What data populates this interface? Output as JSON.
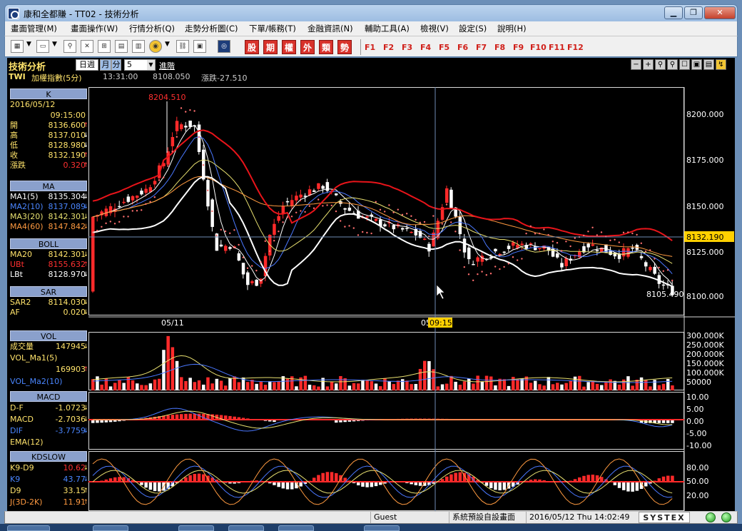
{
  "window": {
    "title": "康和全都賺 - TT02 - 技術分析",
    "min": "▁",
    "max": "❐",
    "close": "✕"
  },
  "menu": [
    "畫面管理(M)",
    "畫面操作(W)",
    "行情分析(Q)",
    "走勢分析圖(C)",
    "下單/帳務(T)",
    "金融資訊(N)",
    "輔助工具(A)",
    "檢視(V)",
    "設定(S)",
    "說明(H)"
  ],
  "toolbar": {
    "red_buttons": [
      "股",
      "期",
      "權",
      "外",
      "類",
      "勢"
    ],
    "fkeys": [
      "F1",
      "F2",
      "F3",
      "F4",
      "F5",
      "F6",
      "F7",
      "F8",
      "F9",
      "F10",
      "F11",
      "F12"
    ]
  },
  "header": {
    "title": "技術分析",
    "period_day": "日週",
    "period_month": "月",
    "period_min": "分",
    "period_n": "5",
    "advanced": "進階",
    "code": "TWI",
    "name": "加權指數(5分)",
    "time": "13:31:00",
    "price": "8108.050",
    "change_label": "漲跌-27.510",
    "controls": [
      "−",
      "+",
      "⚲",
      "⚲",
      "☐",
      "▣",
      "▤",
      "↯"
    ]
  },
  "left_panel": {
    "k": {
      "header": "K",
      "date": "2016/05/12",
      "time": "09:15:00",
      "rows": [
        {
          "k": "開",
          "v": "8136.600",
          "a": "↑"
        },
        {
          "k": "高",
          "v": "8137.010",
          "a": "↓"
        },
        {
          "k": "低",
          "v": "8128.980",
          "a": "↓"
        },
        {
          "k": "收",
          "v": "8132.190",
          "a": "↑"
        },
        {
          "k": "漲跌",
          "v": "0.320",
          "a": "↑"
        }
      ]
    },
    "ma": {
      "header": "MA",
      "rows": [
        {
          "k": "MA1(5)",
          "v": "8135.304",
          "a": "↓"
        },
        {
          "k": "MA2(10)",
          "v": "8137.089",
          "a": "↓"
        },
        {
          "k": "MA3(20)",
          "v": "8142.301",
          "a": "↓"
        },
        {
          "k": "MA4(60)",
          "v": "8147.842",
          "a": "↓"
        }
      ]
    },
    "boll": {
      "header": "BOLL",
      "rows": [
        {
          "k": "MA20",
          "v": "8142.301",
          "a": "↓"
        },
        {
          "k": "UBt",
          "v": "8155.632",
          "a": "↑"
        },
        {
          "k": "LBt",
          "v": "8128.970",
          "a": "↓"
        }
      ]
    },
    "sar": {
      "header": "SAR",
      "rows": [
        {
          "k": "SAR2",
          "v": "8114.030",
          "a": "↓"
        },
        {
          "k": "AF",
          "v": "0.020",
          "a": "↓"
        }
      ]
    },
    "vol": {
      "header": "VOL",
      "rows": [
        {
          "k": "成交量",
          "v": "147945",
          "a": "↓"
        },
        {
          "k": "VOL_Ma1(5)",
          "v": "",
          "a": ""
        },
        {
          "k": "",
          "v": "169903",
          "a": "↑"
        },
        {
          "k": "VOL_Ma2(10)",
          "v": "",
          "a": ""
        }
      ]
    },
    "macd": {
      "header": "MACD",
      "rows": [
        {
          "k": "D-F",
          "v": "-1.0723",
          "a": "↓"
        },
        {
          "k": "MACD",
          "v": "-2.7036",
          "a": "↓"
        },
        {
          "k": "DIF",
          "v": "-3.7759",
          "a": "↓"
        },
        {
          "k": "EMA(12)",
          "v": "",
          "a": ""
        }
      ]
    },
    "kdslow": {
      "header": "KDSLOW",
      "rows": [
        {
          "k": "K9-D9",
          "v": "10.62",
          "a": "↓"
        },
        {
          "k": "K9",
          "v": "43.77",
          "a": "↓"
        },
        {
          "k": "D9",
          "v": "33.15",
          "a": "↑"
        },
        {
          "k": "J(3D-2K)",
          "v": "11.91",
          "a": "↑"
        }
      ]
    }
  },
  "chart": {
    "price_ticks": [
      "8200.000",
      "8175.000",
      "8150.000",
      "8125.000",
      "8100.000"
    ],
    "high_label": "8204.510",
    "low_label": "8105.490",
    "current_price": "8132.190",
    "date_labels": [
      "05/11",
      "05"
    ],
    "cursor_time": "09:15",
    "vol_ticks": [
      "300.000K",
      "250.000K",
      "200.000K",
      "150.000K",
      "100.000K",
      "50000"
    ],
    "macd_ticks": [
      "10.00",
      "5.00",
      "0.00",
      "-5.00",
      "-10.00"
    ],
    "kd_ticks": [
      "80.00",
      "50.00",
      "20.00"
    ]
  },
  "chart_data": {
    "type": "candlestick",
    "title": "加權指數(5分)",
    "ylim": [
      8095,
      8215
    ],
    "annotations": [
      "8204.510",
      "8105.490",
      "8132.190"
    ],
    "x_labels": [
      "05/11",
      "05/12 09:15"
    ]
  },
  "status": {
    "user": "Guest",
    "layout": "系統預設自設畫面",
    "datetime": "2016/05/12 Thu 14:02:49",
    "brand": "SYSTEX"
  },
  "colors": {
    "up": "#ff2a2a",
    "down": "#ffffff",
    "boll": "#e8141a",
    "ma_blue": "#4a78ff",
    "ma_yellow": "#e8e070",
    "ma_orange": "#ff9a40",
    "sar": "#ff6f6f",
    "bg": "#000000"
  }
}
